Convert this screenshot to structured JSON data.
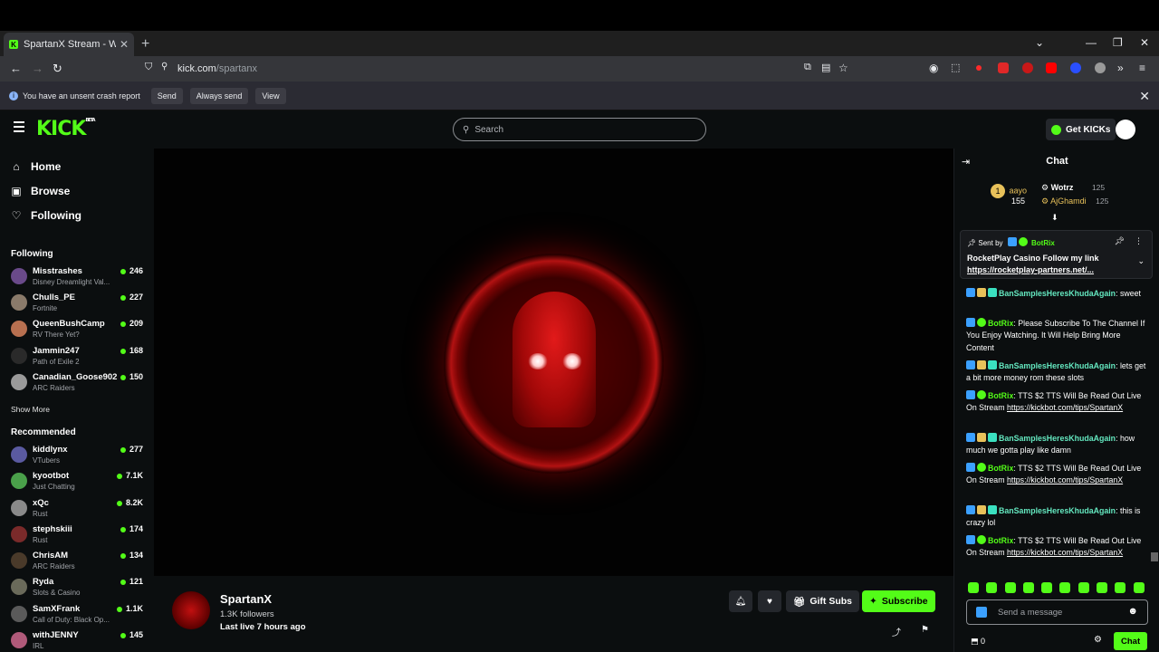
{
  "browser": {
    "tab_title": "SpartanX Stream - Watch Live o",
    "url_host": "kick.com",
    "url_path": "/spartanx",
    "infobar": {
      "message": "You have an unsent crash report",
      "send": "Send",
      "always_send": "Always send",
      "view": "View"
    }
  },
  "header": {
    "logo": "KICK",
    "logo_tag": "BETA",
    "search_placeholder": "Search",
    "get_kicks": "Get KICKs"
  },
  "sidebar": {
    "nav": [
      {
        "label": "Home",
        "icon": "home-icon"
      },
      {
        "label": "Browse",
        "icon": "browse-icon"
      },
      {
        "label": "Following",
        "icon": "heart-icon"
      }
    ],
    "following_title": "Following",
    "following": [
      {
        "name": "Misstrashes",
        "game": "Disney Dreamlight Val...",
        "viewers": "246"
      },
      {
        "name": "Chulls_PE",
        "game": "Fortnite",
        "viewers": "227"
      },
      {
        "name": "QueenBushCamp",
        "game": "RV There Yet?",
        "viewers": "209"
      },
      {
        "name": "Jammin247",
        "game": "Path of Exile 2",
        "viewers": "168"
      },
      {
        "name": "Canadian_Goose902",
        "game": "ARC Raiders",
        "viewers": "150"
      }
    ],
    "show_more": "Show More",
    "recommended_title": "Recommended",
    "recommended": [
      {
        "name": "kiddlynx",
        "game": "VTubers",
        "viewers": "277"
      },
      {
        "name": "kyootbot",
        "game": "Just Chatting",
        "viewers": "7.1K"
      },
      {
        "name": "xQc",
        "game": "Rust",
        "viewers": "8.2K"
      },
      {
        "name": "stephskiii",
        "game": "Rust",
        "viewers": "174"
      },
      {
        "name": "ChrisAM",
        "game": "ARC Raiders",
        "viewers": "134"
      },
      {
        "name": "Ryda",
        "game": "Slots & Casino",
        "viewers": "121"
      },
      {
        "name": "SamXFrank",
        "game": "Call of Duty: Black Op...",
        "viewers": "1.1K"
      },
      {
        "name": "withJENNY",
        "game": "IRL",
        "viewers": "145"
      }
    ]
  },
  "channel": {
    "name": "SpartanX",
    "followers": "1.3K followers",
    "last_live": "Last live 7 hours ago",
    "gift_subs": "Gift Subs",
    "subscribe": "Subscribe"
  },
  "chat": {
    "title": "Chat",
    "leaders": [
      {
        "rank": "1",
        "name": "aayo",
        "value": "155"
      },
      {
        "name": "Wotrz",
        "value": "125"
      },
      {
        "name": "AjGhamdi",
        "value": "125"
      }
    ],
    "pinned": {
      "sent_by": "Sent by",
      "author": "BotRix",
      "text": "RocketPlay Casino Follow my link",
      "link": "https://rocketplay-partners.net/..."
    },
    "messages": [
      {
        "user": "BanSamplesHeresKhudaAgain",
        "text": "sweet"
      },
      {
        "user": "BotRix",
        "text": "Please Subscribe To The Channel If You Enjoy Watching. It Will Help Bring More Content"
      },
      {
        "user": "BanSamplesHeresKhudaAgain",
        "text": "lets get a bit more money rom these slots"
      },
      {
        "user": "BotRix",
        "text": "TTS $2 TTS Will Be Read Out Live On Stream",
        "link": "https://kickbot.com/tips/SpartanX"
      },
      {
        "user": "BanSamplesHeresKhudaAgain",
        "text": "how much we gotta play like damn"
      },
      {
        "user": "BotRix",
        "text": "TTS $2 TTS Will Be Read Out Live On Stream",
        "link": "https://kickbot.com/tips/SpartanX"
      },
      {
        "user": "BanSamplesHeresKhudaAgain",
        "text": "this is crazy lol"
      },
      {
        "user": "BotRix",
        "text": "TTS $2 TTS Will Be Read Out Live On Stream",
        "link": "https://kickbot.com/tips/SpartanX"
      }
    ],
    "input_placeholder": "Send a message",
    "count": "0",
    "chat_button": "Chat"
  },
  "colors": {
    "accent": "#53fc18",
    "bg": "#0b0e0f"
  }
}
